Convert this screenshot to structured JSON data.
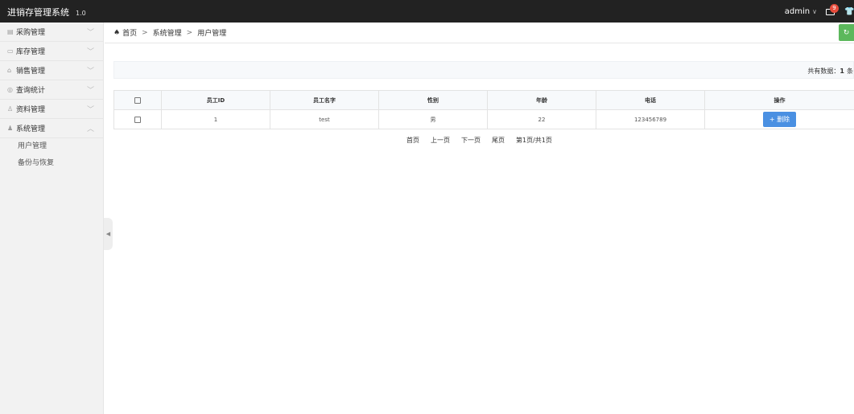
{
  "app": {
    "title": "进销存管理系统",
    "version": "1.0"
  },
  "topbar": {
    "user": "admin",
    "caret": "∨",
    "notification_count": "9",
    "shirt_glyph": "👕"
  },
  "sidebar": {
    "items": [
      {
        "label": "采购管理",
        "icon": "▤"
      },
      {
        "label": "库存管理",
        "icon": "▭"
      },
      {
        "label": "销售管理",
        "icon": "⌂"
      },
      {
        "label": "查询统计",
        "icon": "◎"
      },
      {
        "label": "资料管理",
        "icon": "♙"
      },
      {
        "label": "系统管理",
        "icon": "♟"
      }
    ],
    "sub_items": [
      {
        "label": "用户管理"
      },
      {
        "label": "备份与恢复"
      }
    ]
  },
  "breadcrumb": {
    "home": "首页",
    "level1": "系统管理",
    "level2": "用户管理",
    "sep": ">"
  },
  "summary": {
    "prefix": "共有数据：",
    "count": "1",
    "suffix": "条"
  },
  "table": {
    "headers": [
      "员工ID",
      "员工名字",
      "性别",
      "年龄",
      "电话",
      "操作"
    ],
    "rows": [
      {
        "id": "1",
        "name": "test",
        "gender": "男",
        "age": "22",
        "phone": "123456789",
        "action": "+ 删除"
      }
    ]
  },
  "pager": {
    "first": "首页",
    "prev": "上一页",
    "next": "下一页",
    "last": "尾页",
    "info": "第1页/共1页"
  },
  "colors": {
    "topbar": "#222222",
    "sidebar": "#f2f2f2",
    "refresh": "#5cb85c",
    "primary": "#4a90e2",
    "badge": "#e74c3c"
  }
}
